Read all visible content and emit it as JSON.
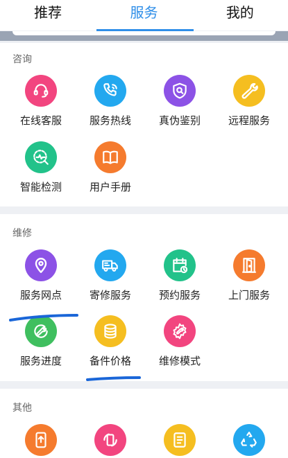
{
  "tabs": [
    {
      "label": "推荐"
    },
    {
      "label": "服务"
    },
    {
      "label": "我的"
    }
  ],
  "active_tab": "服务",
  "sections": {
    "consult": {
      "title": "咨询",
      "items": [
        {
          "label": "在线客服",
          "icon": "headset-icon",
          "color": "#f2457f"
        },
        {
          "label": "服务热线",
          "icon": "phone-icon",
          "color": "#23a8ef"
        },
        {
          "label": "真伪鉴别",
          "icon": "shield-search-icon",
          "color": "#8c52e6"
        },
        {
          "label": "远程服务",
          "icon": "wrench-icon",
          "color": "#f5be20"
        },
        {
          "label": "智能检测",
          "icon": "detect-icon",
          "color": "#22c28a"
        },
        {
          "label": "用户手册",
          "icon": "book-icon",
          "color": "#f57b2e"
        }
      ]
    },
    "repair": {
      "title": "维修",
      "items": [
        {
          "label": "服务网点",
          "icon": "location-pin-icon",
          "color": "#8c52e6"
        },
        {
          "label": "寄修服务",
          "icon": "truck-icon",
          "color": "#23a8ef"
        },
        {
          "label": "预约服务",
          "icon": "calendar-clock-icon",
          "color": "#22c28a"
        },
        {
          "label": "上门服务",
          "icon": "door-icon",
          "color": "#f57b2e"
        },
        {
          "label": "服务进度",
          "icon": "progress-wrench-icon",
          "color": "#3fbf5f"
        },
        {
          "label": "备件价格",
          "icon": "coins-icon",
          "color": "#f5be20"
        },
        {
          "label": "维修模式",
          "icon": "gear-wrench-icon",
          "color": "#f2457f"
        }
      ]
    },
    "other": {
      "title": "其他",
      "items": [
        {
          "icon": "phone-upload-icon",
          "color": "#f57b2e"
        },
        {
          "icon": "phone-refresh-icon",
          "color": "#f2457f"
        },
        {
          "icon": "document-icon",
          "color": "#f5be20"
        },
        {
          "icon": "recycle-icon",
          "color": "#23a8ef"
        }
      ]
    }
  },
  "annotation_color": "#1a66d8"
}
